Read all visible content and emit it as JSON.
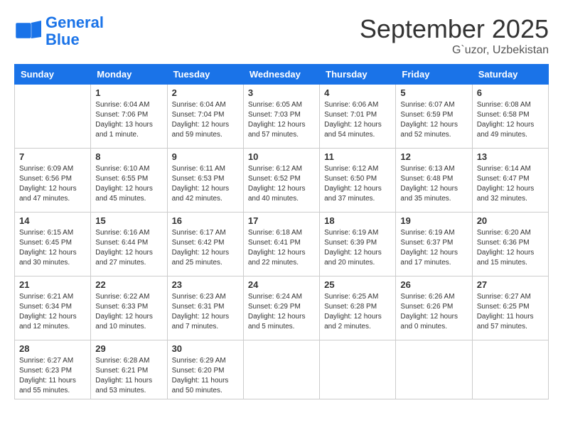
{
  "logo": {
    "line1": "General",
    "line2": "Blue"
  },
  "title": "September 2025",
  "subtitle": "G`uzor, Uzbekistan",
  "days_of_week": [
    "Sunday",
    "Monday",
    "Tuesday",
    "Wednesday",
    "Thursday",
    "Friday",
    "Saturday"
  ],
  "weeks": [
    [
      {
        "day": "",
        "info": ""
      },
      {
        "day": "1",
        "info": "Sunrise: 6:04 AM\nSunset: 7:06 PM\nDaylight: 13 hours\nand 1 minute."
      },
      {
        "day": "2",
        "info": "Sunrise: 6:04 AM\nSunset: 7:04 PM\nDaylight: 12 hours\nand 59 minutes."
      },
      {
        "day": "3",
        "info": "Sunrise: 6:05 AM\nSunset: 7:03 PM\nDaylight: 12 hours\nand 57 minutes."
      },
      {
        "day": "4",
        "info": "Sunrise: 6:06 AM\nSunset: 7:01 PM\nDaylight: 12 hours\nand 54 minutes."
      },
      {
        "day": "5",
        "info": "Sunrise: 6:07 AM\nSunset: 6:59 PM\nDaylight: 12 hours\nand 52 minutes."
      },
      {
        "day": "6",
        "info": "Sunrise: 6:08 AM\nSunset: 6:58 PM\nDaylight: 12 hours\nand 49 minutes."
      }
    ],
    [
      {
        "day": "7",
        "info": "Sunrise: 6:09 AM\nSunset: 6:56 PM\nDaylight: 12 hours\nand 47 minutes."
      },
      {
        "day": "8",
        "info": "Sunrise: 6:10 AM\nSunset: 6:55 PM\nDaylight: 12 hours\nand 45 minutes."
      },
      {
        "day": "9",
        "info": "Sunrise: 6:11 AM\nSunset: 6:53 PM\nDaylight: 12 hours\nand 42 minutes."
      },
      {
        "day": "10",
        "info": "Sunrise: 6:12 AM\nSunset: 6:52 PM\nDaylight: 12 hours\nand 40 minutes."
      },
      {
        "day": "11",
        "info": "Sunrise: 6:12 AM\nSunset: 6:50 PM\nDaylight: 12 hours\nand 37 minutes."
      },
      {
        "day": "12",
        "info": "Sunrise: 6:13 AM\nSunset: 6:48 PM\nDaylight: 12 hours\nand 35 minutes."
      },
      {
        "day": "13",
        "info": "Sunrise: 6:14 AM\nSunset: 6:47 PM\nDaylight: 12 hours\nand 32 minutes."
      }
    ],
    [
      {
        "day": "14",
        "info": "Sunrise: 6:15 AM\nSunset: 6:45 PM\nDaylight: 12 hours\nand 30 minutes."
      },
      {
        "day": "15",
        "info": "Sunrise: 6:16 AM\nSunset: 6:44 PM\nDaylight: 12 hours\nand 27 minutes."
      },
      {
        "day": "16",
        "info": "Sunrise: 6:17 AM\nSunset: 6:42 PM\nDaylight: 12 hours\nand 25 minutes."
      },
      {
        "day": "17",
        "info": "Sunrise: 6:18 AM\nSunset: 6:41 PM\nDaylight: 12 hours\nand 22 minutes."
      },
      {
        "day": "18",
        "info": "Sunrise: 6:19 AM\nSunset: 6:39 PM\nDaylight: 12 hours\nand 20 minutes."
      },
      {
        "day": "19",
        "info": "Sunrise: 6:19 AM\nSunset: 6:37 PM\nDaylight: 12 hours\nand 17 minutes."
      },
      {
        "day": "20",
        "info": "Sunrise: 6:20 AM\nSunset: 6:36 PM\nDaylight: 12 hours\nand 15 minutes."
      }
    ],
    [
      {
        "day": "21",
        "info": "Sunrise: 6:21 AM\nSunset: 6:34 PM\nDaylight: 12 hours\nand 12 minutes."
      },
      {
        "day": "22",
        "info": "Sunrise: 6:22 AM\nSunset: 6:33 PM\nDaylight: 12 hours\nand 10 minutes."
      },
      {
        "day": "23",
        "info": "Sunrise: 6:23 AM\nSunset: 6:31 PM\nDaylight: 12 hours\nand 7 minutes."
      },
      {
        "day": "24",
        "info": "Sunrise: 6:24 AM\nSunset: 6:29 PM\nDaylight: 12 hours\nand 5 minutes."
      },
      {
        "day": "25",
        "info": "Sunrise: 6:25 AM\nSunset: 6:28 PM\nDaylight: 12 hours\nand 2 minutes."
      },
      {
        "day": "26",
        "info": "Sunrise: 6:26 AM\nSunset: 6:26 PM\nDaylight: 12 hours\nand 0 minutes."
      },
      {
        "day": "27",
        "info": "Sunrise: 6:27 AM\nSunset: 6:25 PM\nDaylight: 11 hours\nand 57 minutes."
      }
    ],
    [
      {
        "day": "28",
        "info": "Sunrise: 6:27 AM\nSunset: 6:23 PM\nDaylight: 11 hours\nand 55 minutes."
      },
      {
        "day": "29",
        "info": "Sunrise: 6:28 AM\nSunset: 6:21 PM\nDaylight: 11 hours\nand 53 minutes."
      },
      {
        "day": "30",
        "info": "Sunrise: 6:29 AM\nSunset: 6:20 PM\nDaylight: 11 hours\nand 50 minutes."
      },
      {
        "day": "",
        "info": ""
      },
      {
        "day": "",
        "info": ""
      },
      {
        "day": "",
        "info": ""
      },
      {
        "day": "",
        "info": ""
      }
    ]
  ]
}
